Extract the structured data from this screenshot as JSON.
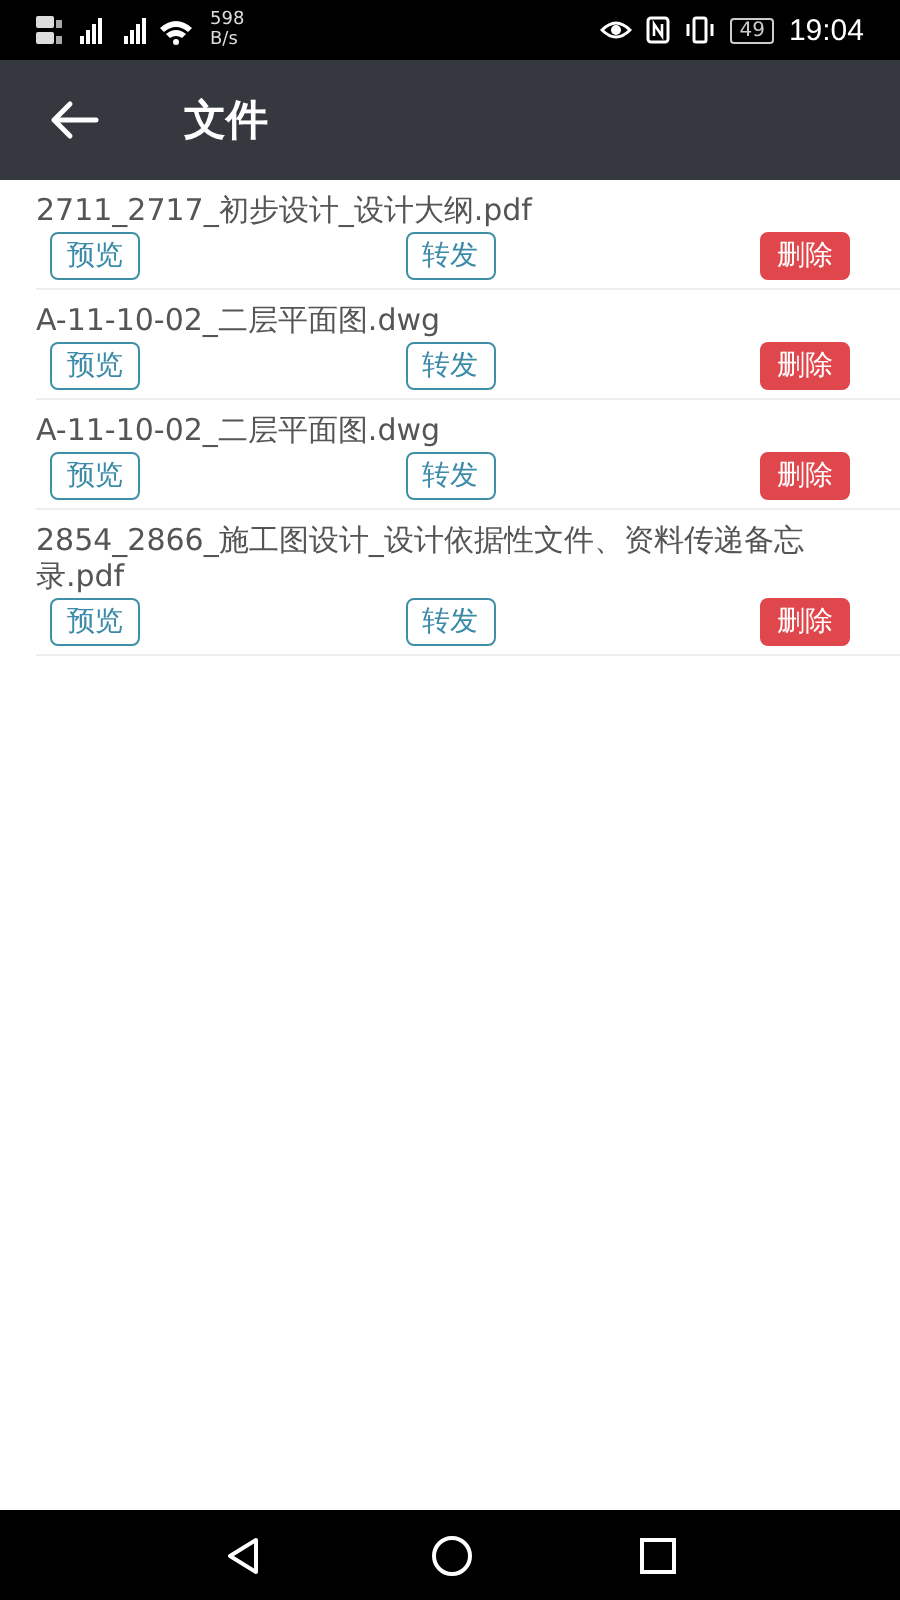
{
  "status_bar": {
    "net_speed_value": "598",
    "net_speed_unit": "B/s",
    "battery": "49",
    "time": "19:04"
  },
  "app_bar": {
    "title": "文件"
  },
  "files": [
    {
      "name": "2711_2717_初步设计_设计大纲.pdf",
      "actions": [
        "预览",
        "转发",
        "删除"
      ]
    },
    {
      "name": "A-11-10-02_二层平面图.dwg",
      "actions": [
        "预览",
        "转发",
        "删除"
      ]
    },
    {
      "name": "A-11-10-02_二层平面图.dwg",
      "actions": [
        "预览",
        "转发",
        "删除"
      ]
    },
    {
      "name": "2854_2866_施工图设计_设计依据性文件、资料传递备忘录.pdf",
      "actions": [
        "预览",
        "转发",
        "删除"
      ]
    }
  ]
}
